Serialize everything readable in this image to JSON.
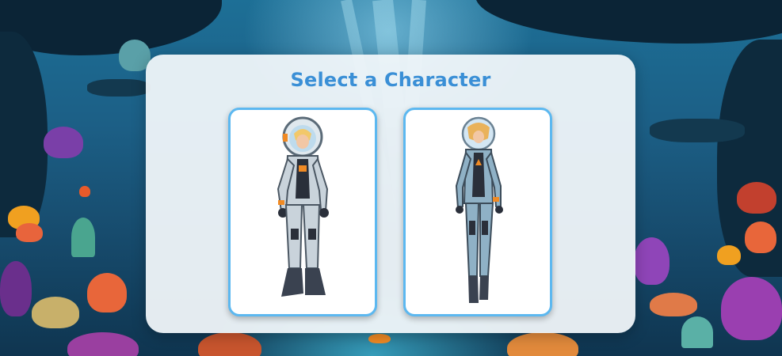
{
  "screen": {
    "title": "Select a Character"
  },
  "characters": [
    {
      "id": 1,
      "name": "diver-boy",
      "suit_color": "#c9d3db",
      "accent_color": "#f08a24"
    },
    {
      "id": 2,
      "name": "diver-girl",
      "suit_color": "#8fb1c6",
      "accent_color": "#f08a24"
    }
  ],
  "colors": {
    "panel_bg": "#f1f6fa",
    "title": "#3a8fd6",
    "card_border": "#5cb8f0",
    "water": "#1c5f86"
  }
}
